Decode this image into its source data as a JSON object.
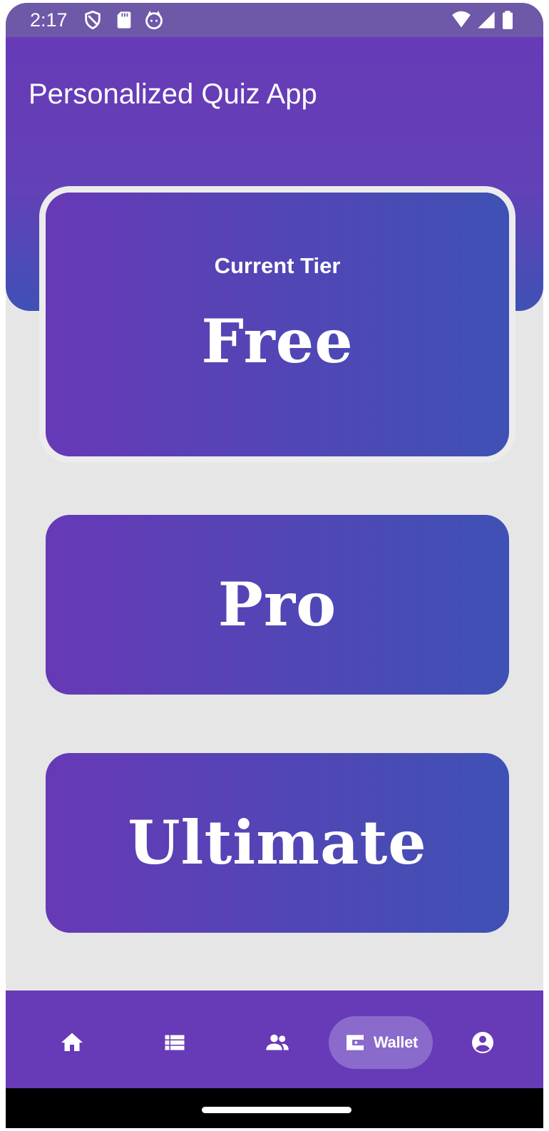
{
  "status_bar": {
    "time": "2:17",
    "left_icons": [
      "shield-icon",
      "sd-card-icon",
      "cat-face-icon"
    ],
    "right_icons": [
      "wifi-icon",
      "signal-icon",
      "battery-icon"
    ]
  },
  "app": {
    "title": "Personalized Quiz App"
  },
  "tiers": {
    "current_caption": "Current Tier",
    "current": "Free",
    "pro": "Pro",
    "ultimate": "Ultimate"
  },
  "bottom_nav": {
    "items": [
      {
        "icon": "home-icon",
        "label": ""
      },
      {
        "icon": "list-icon",
        "label": ""
      },
      {
        "icon": "people-icon",
        "label": ""
      },
      {
        "icon": "wallet-icon",
        "label": "Wallet",
        "selected": true
      },
      {
        "icon": "account-circle-icon",
        "label": ""
      }
    ]
  },
  "colors": {
    "primary": "#673ab7",
    "secondary": "#3f51b5",
    "background": "#e6e6e6",
    "nav_selected_pill": "#8a6acb"
  }
}
